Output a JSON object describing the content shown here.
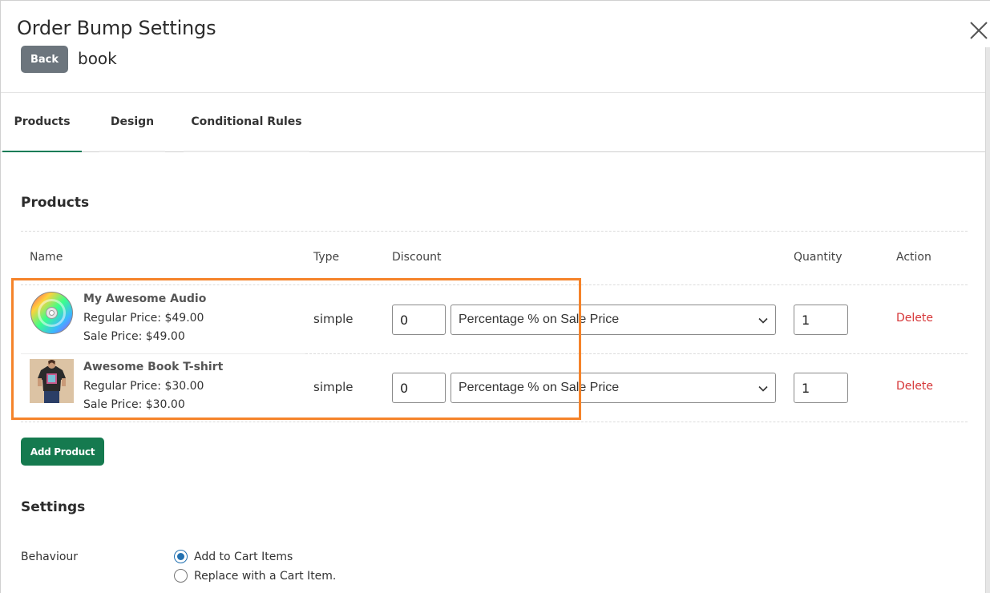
{
  "header": {
    "title": "Order Bump Settings",
    "back_label": "Back",
    "subtitle": "book"
  },
  "tabs": [
    {
      "label": "Products",
      "active": true
    },
    {
      "label": "Design",
      "active": false
    },
    {
      "label": "Conditional Rules",
      "active": false
    }
  ],
  "products_section": {
    "title": "Products",
    "columns": [
      "Name",
      "Type",
      "Discount",
      "Quantity",
      "Action"
    ],
    "rows": [
      {
        "name": "My Awesome Audio",
        "regular_price": "Regular Price: $49.00",
        "sale_price": "Sale Price: $49.00",
        "type": "simple",
        "discount": "0",
        "discount_type": "Percentage % on Sale Price",
        "quantity": "1",
        "action": "Delete",
        "thumb_icon": "cd-disc-icon"
      },
      {
        "name": "Awesome Book T-shirt",
        "regular_price": "Regular Price: $30.00",
        "sale_price": "Sale Price: $30.00",
        "type": "simple",
        "discount": "0",
        "discount_type": "Percentage % on Sale Price",
        "quantity": "1",
        "action": "Delete",
        "thumb_icon": "tshirt-photo-icon"
      }
    ],
    "add_button_label": "Add Product"
  },
  "settings": {
    "title": "Settings",
    "behaviour_label": "Behaviour",
    "options": [
      {
        "label": "Add to Cart Items",
        "checked": true
      },
      {
        "label": "Replace with a Cart Item.",
        "checked": false
      }
    ]
  },
  "colors": {
    "accent_green": "#157a4f",
    "back_gray": "#6c757d",
    "delete_red": "#d63638",
    "highlight_orange": "#f5832a",
    "radio_blue": "#2271b1"
  }
}
